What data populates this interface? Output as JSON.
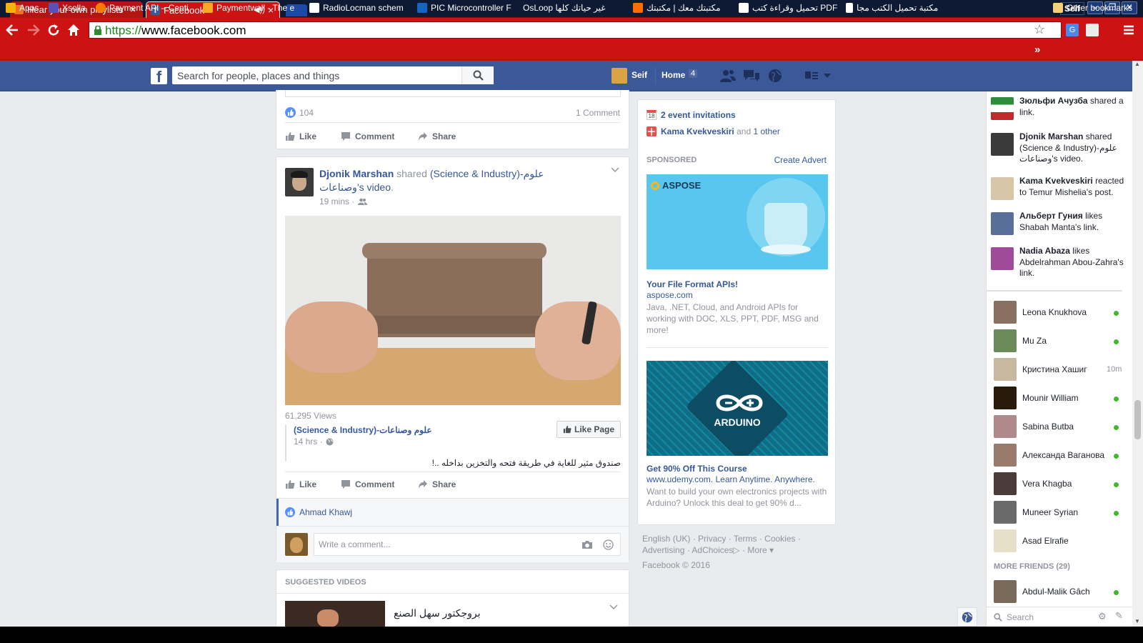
{
  "browser": {
    "tabs": [
      {
        "title": "Hear your own playlists",
        "active": false
      },
      {
        "title": "Facebook",
        "active": true
      }
    ],
    "profile_label": "Seif",
    "url_scheme": "https://",
    "url_host": "www.facebook.com",
    "bookmarks": [
      {
        "label": "Apps",
        "color": "#f4b400"
      },
      {
        "label": "Xsolla",
        "color": "#5b4fb8"
      },
      {
        "label": "Payment API – Centi",
        "color": "#f57c00"
      },
      {
        "label": "Paymentwall - The e",
        "color": "#f9a825"
      },
      {
        "label": "RadioLocman schem",
        "color": "#ffffff"
      },
      {
        "label": "PIC Microcontroller F",
        "color": "#1565c0"
      },
      {
        "label": "OsLoop غير حياتك كلها",
        "color": "#ffffff"
      },
      {
        "label": "مكتبتك معك | مكتبتك",
        "color": "#ff6d00"
      },
      {
        "label": "تحميل وقراءة كتب PDF",
        "color": "#ffffff"
      },
      {
        "label": "مكتبة تحميل الكتب مجا",
        "color": "#ffffff"
      }
    ],
    "bookmarks_overflow": "»",
    "other_bookmarks": "Other bookmarks",
    "colors": {
      "chrome_red": "#cc1212",
      "titlebar": "#0e1a33",
      "fb_blue": "#3b5998"
    }
  },
  "fb_header": {
    "search_placeholder": "Search for people, places and things",
    "user_name": "Seif",
    "home_label": "Home",
    "home_count": "4"
  },
  "feed": {
    "prev_post": {
      "likes": "104",
      "comments": "1 Comment"
    },
    "actions": {
      "like": "Like",
      "comment": "Comment",
      "share": "Share"
    },
    "post": {
      "author": "Djonik Marshan",
      "verb": "shared",
      "page_name": "(Science & Industry)-علوم وصناعات",
      "suffix": "'s",
      "object": "video",
      "time": "19 mins ·",
      "views": "61,295 Views",
      "shared_page": "(Science & Industry)-علوم وصناعات",
      "shared_time": "14 hrs ·",
      "like_page": "Like Page",
      "caption": "صندوق مثير للغاية في طريقة فتحه والتخزين بداخله ..!",
      "liker": "Ahmad Khawj",
      "comment_placeholder": "Write a comment..."
    },
    "suggested": {
      "title": "SUGGESTED VIDEOS",
      "first_video": "بروجكتور سهل الصنع"
    }
  },
  "right_col": {
    "event_invites": "2 event invitations",
    "event_icon_day": "18",
    "birthday_name": "Kama Kvekveskiri",
    "birthday_conj": "and",
    "birthday_other": "1 other",
    "sponsored": "SPONSORED",
    "create_advert": "Create Advert",
    "ads": [
      {
        "brand": "ASPOSE",
        "title": "Your File Format APIs!",
        "domain": "aspose.com",
        "body": "Java, .NET, Cloud, and Android APIs for working with DOC, XLS, PPT, PDF, MSG and more!"
      },
      {
        "brand": "ARDUINO",
        "title": "Get 90% Off This Course",
        "domain": "www.udemy.com. Learn Anytime. Anywhere.",
        "body": "Want to build your own electronics projects with Arduino? Unlock this deal to get 90% d..."
      }
    ],
    "footer": {
      "links": [
        "English (UK)",
        "Privacy",
        "Terms",
        "Cookies",
        "Advertising",
        "AdChoices",
        "More"
      ],
      "copyright": "Facebook © 2016"
    }
  },
  "ticker": [
    {
      "name": "Зюльфи Ачузба",
      "text": "shared a link."
    },
    {
      "name": "Djonik Marshan",
      "text": "shared (Science & Industry)-علوم وصناعات's video."
    },
    {
      "name": "Kama Kvekveskiri",
      "text": "reacted to Temur Mishelia's post."
    },
    {
      "name": "Альберт Гуния",
      "text": "likes Shabah Manta's link."
    },
    {
      "name": "Nadia Abaza",
      "text": "likes Abdelrahman Abou-Zahra's link."
    }
  ],
  "chat": {
    "friends": [
      {
        "name": "Leona Knukhova",
        "status": "online"
      },
      {
        "name": "Mu Za",
        "status": "online"
      },
      {
        "name": "Кристина Хашиг",
        "status": "10m"
      },
      {
        "name": "Mounir William",
        "status": "online"
      },
      {
        "name": "Sabina Butba",
        "status": "online"
      },
      {
        "name": "Александа Ваганова",
        "status": "online"
      },
      {
        "name": "Vera Khagba",
        "status": "online"
      },
      {
        "name": "Muneer Syrian",
        "status": "online"
      },
      {
        "name": "Asad Elrafie",
        "status": ""
      }
    ],
    "more_friends": "MORE FRIENDS (29)",
    "more_list": [
      {
        "name": "Abdul-Malik Gâch",
        "status": "online"
      }
    ],
    "search_placeholder": "Search"
  }
}
